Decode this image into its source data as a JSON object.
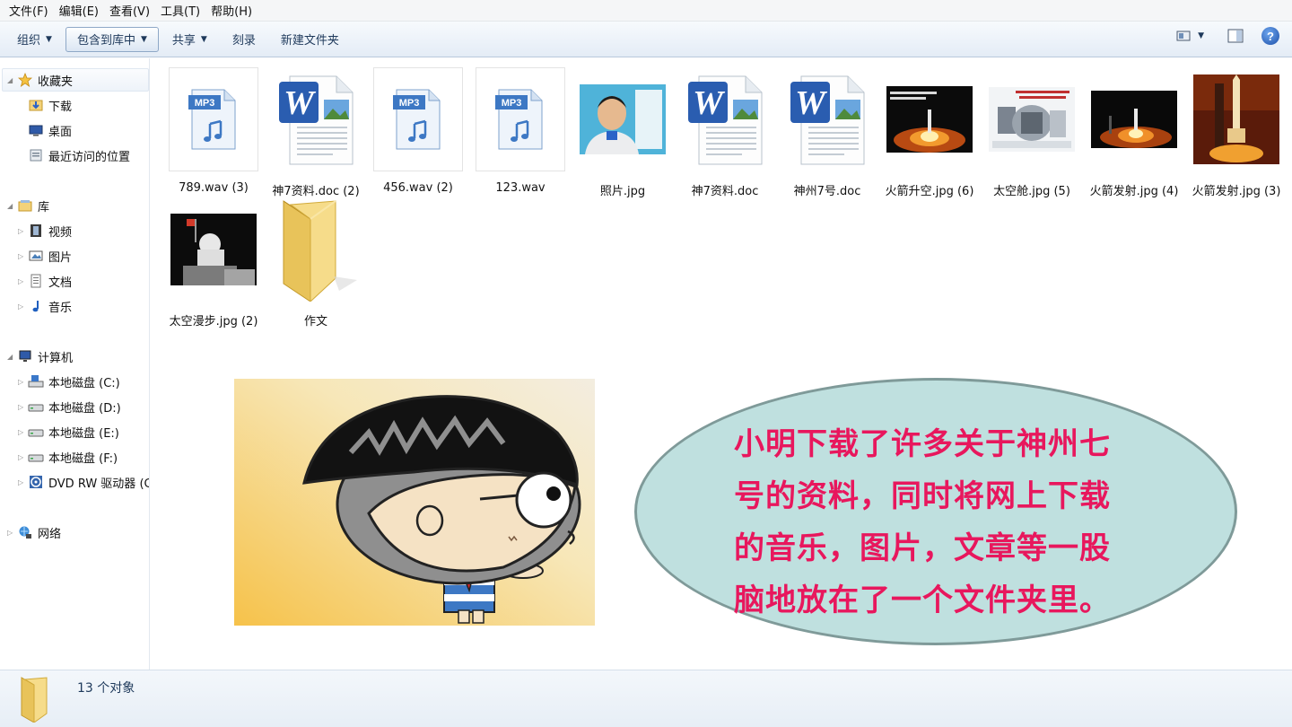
{
  "menubar": {
    "items": [
      "文件(F)",
      "编辑(E)",
      "查看(V)",
      "工具(T)",
      "帮助(H)"
    ]
  },
  "toolbar": {
    "organize": "组织",
    "include_library": "包含到库中",
    "share": "共享",
    "burn": "刻录",
    "new_folder": "新建文件夹"
  },
  "sidebar": {
    "favorites": "收藏夹",
    "downloads": "下载",
    "desktop": "桌面",
    "recent": "最近访问的位置",
    "libraries": "库",
    "videos": "视频",
    "pictures": "图片",
    "documents": "文档",
    "music": "音乐",
    "computer": "计算机",
    "disk_c": "本地磁盘 (C:)",
    "disk_d": "本地磁盘 (D:)",
    "disk_e": "本地磁盘 (E:)",
    "disk_f": "本地磁盘 (F:)",
    "dvd": "DVD RW 驱动器 (G",
    "network": "网络"
  },
  "files": [
    {
      "name": "789.wav (3)",
      "kind": "mp3",
      "badge": "MP3"
    },
    {
      "name": "神7资料.doc (2)",
      "kind": "word"
    },
    {
      "name": "456.wav (2)",
      "kind": "mp3",
      "badge": "MP3"
    },
    {
      "name": "123.wav",
      "kind": "mp3",
      "badge": "MP3"
    },
    {
      "name": "照片.jpg",
      "kind": "photo-portrait"
    },
    {
      "name": "神7资料.doc",
      "kind": "word"
    },
    {
      "name": "神州7号.doc",
      "kind": "word"
    },
    {
      "name": "火箭升空.jpg (6)",
      "kind": "photo-launch"
    },
    {
      "name": "太空舱.jpg (5)",
      "kind": "photo-capsule"
    },
    {
      "name": "火箭发射.jpg (4)",
      "kind": "photo-launch"
    },
    {
      "name": "火箭发射.jpg (3)",
      "kind": "photo-rocket"
    },
    {
      "name": "太空漫步.jpg (2)",
      "kind": "photo-spacewalk"
    },
    {
      "name": "作文",
      "kind": "folder"
    }
  ],
  "status": {
    "count": "13 个对象"
  },
  "speech": {
    "lines": [
      "小明下载了许多关于神州七",
      "号的资料，同时将网上下载",
      "的音乐，图片，文章等一股",
      "脑地放在了一个文件夹里。"
    ]
  },
  "colors": {
    "speech_text": "#e8175d",
    "oval_fill": "#bfe0df",
    "toolbar_text": "#1e395b"
  }
}
